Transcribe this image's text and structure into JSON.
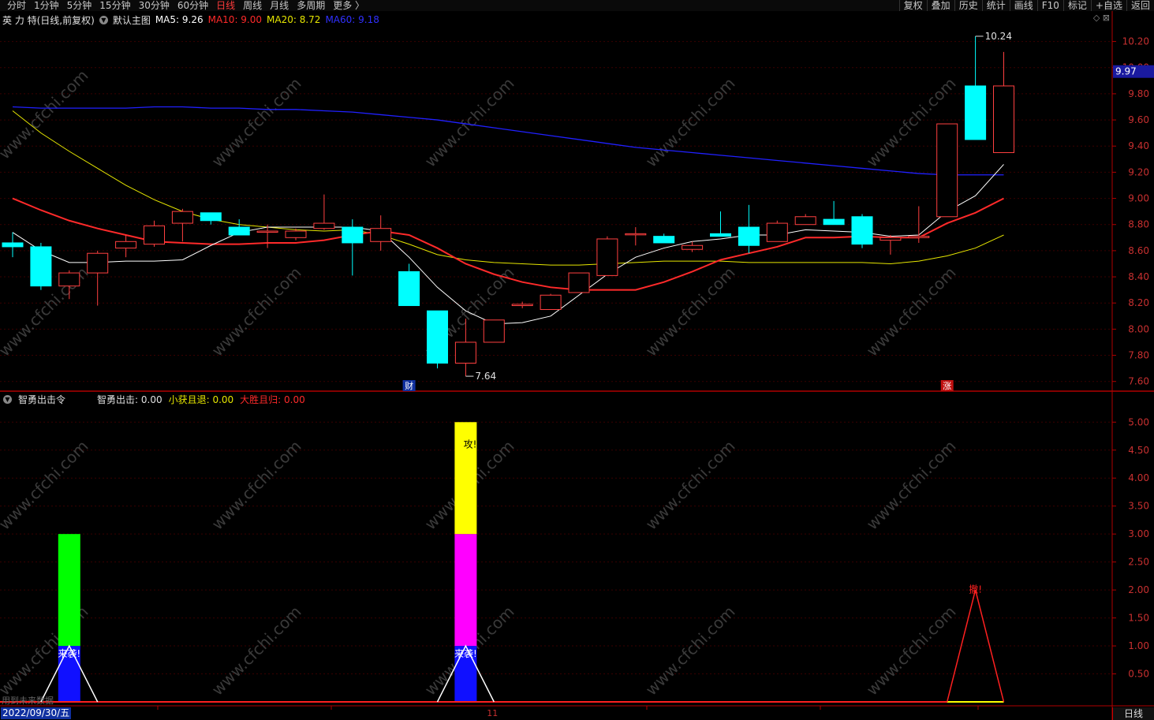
{
  "toolbar": {
    "left_items": [
      "分时",
      "1分钟",
      "5分钟",
      "15分钟",
      "30分钟",
      "60分钟",
      "日线",
      "周线",
      "月线",
      "多周期",
      "更多 〉"
    ],
    "active_index": 6,
    "right_items": [
      "复权",
      "叠加",
      "历史",
      "统计",
      "画线",
      "F10",
      "标记",
      "+自选",
      "返回"
    ]
  },
  "main_chart": {
    "stock_title": "英 力 特(日线,前复权)",
    "template_name": "默认主图",
    "ma5_label": "MA5: 9.26",
    "ma10_label": "MA10: 9.00",
    "ma20_label": "MA20: 8.72",
    "ma60_label": "MA60: 9.18",
    "high_label": "10.24",
    "low_label": "7.64",
    "current_price": "9.97",
    "event_marker_1": "财",
    "event_marker_2": "涨",
    "y_ticks": [
      "10.20",
      "10.00",
      "9.80",
      "9.60",
      "9.40",
      "9.20",
      "9.00",
      "8.80",
      "8.60",
      "8.40",
      "8.20",
      "8.00",
      "7.80",
      "7.60"
    ],
    "colors": {
      "ma5": "#ffffff",
      "ma10": "#ff2a2a",
      "ma20": "#e6e600",
      "ma60": "#2020ff",
      "up": "#ff4040",
      "down": "#00ffff"
    }
  },
  "indicator": {
    "name": "智勇出击令",
    "l1": "智勇出击: 0.00",
    "l2": "小获且退: 0.00",
    "l3": "大胜且归: 0.00",
    "y_ticks": [
      "5.00",
      "4.50",
      "4.00",
      "3.50",
      "3.00",
      "2.50",
      "2.00",
      "1.50",
      "1.00",
      "0.50"
    ],
    "signal_1": "来袭!",
    "signal_2": "来袭!",
    "signal_3": "攻!",
    "signal_4": "撤!"
  },
  "footer": {
    "date": "2022/09/30/五",
    "axis_mark": "11",
    "period_tab": "日线",
    "note": "用到未来数据"
  },
  "watermark": "www.cfchi.com",
  "chart_data": {
    "type": "candlestick",
    "y_range": [
      7.55,
      10.3
    ],
    "candles": [
      [
        8.66,
        8.63,
        8.74,
        8.55
      ],
      [
        8.63,
        8.33,
        8.66,
        8.3
      ],
      [
        8.33,
        8.43,
        8.45,
        8.23
      ],
      [
        8.43,
        8.58,
        8.6,
        8.18
      ],
      [
        8.62,
        8.67,
        8.72,
        8.55
      ],
      [
        8.65,
        8.79,
        8.83,
        8.63
      ],
      [
        8.81,
        8.9,
        8.92,
        8.67
      ],
      [
        8.89,
        8.83,
        8.89,
        8.8
      ],
      [
        8.78,
        8.72,
        8.84,
        8.72
      ],
      [
        8.75,
        8.75,
        8.8,
        8.62
      ],
      [
        8.7,
        8.75,
        8.77,
        8.68
      ],
      [
        8.77,
        8.81,
        9.03,
        8.76
      ],
      [
        8.78,
        8.66,
        8.84,
        8.41
      ],
      [
        8.67,
        8.77,
        8.87,
        8.6
      ],
      [
        8.44,
        8.18,
        8.5,
        8.18
      ],
      [
        8.14,
        7.74,
        8.14,
        7.7
      ],
      [
        7.74,
        7.9,
        8.08,
        7.64
      ],
      [
        7.9,
        8.07,
        8.07,
        7.9
      ],
      [
        8.18,
        8.19,
        8.21,
        8.16
      ],
      [
        8.15,
        8.26,
        8.27,
        8.15
      ],
      [
        8.28,
        8.43,
        8.43,
        8.28
      ],
      [
        8.41,
        8.69,
        8.71,
        8.41
      ],
      [
        8.73,
        8.73,
        8.78,
        8.64
      ],
      [
        8.71,
        8.66,
        8.73,
        8.66
      ],
      [
        8.61,
        8.64,
        8.67,
        8.59
      ],
      [
        8.73,
        8.71,
        8.9,
        8.71
      ],
      [
        8.78,
        8.64,
        8.95,
        8.58
      ],
      [
        8.67,
        8.81,
        8.83,
        8.67
      ],
      [
        8.8,
        8.86,
        8.88,
        8.8
      ],
      [
        8.84,
        8.8,
        8.98,
        8.8
      ],
      [
        8.86,
        8.65,
        8.88,
        8.62
      ],
      [
        8.68,
        8.7,
        8.72,
        8.57
      ],
      [
        8.7,
        8.71,
        8.94,
        8.66
      ],
      [
        8.86,
        9.57,
        9.57,
        8.86
      ],
      [
        9.86,
        9.45,
        10.24,
        9.45
      ],
      [
        9.35,
        9.86,
        10.12,
        9.35
      ]
    ],
    "ma5": [
      8.74,
      8.6,
      8.51,
      8.51,
      8.52,
      8.52,
      8.53,
      8.64,
      8.74,
      8.78,
      8.78,
      8.78,
      8.78,
      8.75,
      8.55,
      8.32,
      8.14,
      8.04,
      8.05,
      8.1,
      8.26,
      8.42,
      8.55,
      8.62,
      8.67,
      8.69,
      8.72,
      8.72,
      8.76,
      8.75,
      8.74,
      8.71,
      8.72,
      8.9,
      9.02,
      9.26
    ],
    "ma10": [
      9.0,
      8.91,
      8.83,
      8.77,
      8.72,
      8.67,
      8.66,
      8.65,
      8.65,
      8.66,
      8.66,
      8.68,
      8.72,
      8.75,
      8.72,
      8.62,
      8.5,
      8.42,
      8.36,
      8.32,
      8.3,
      8.3,
      8.3,
      8.36,
      8.44,
      8.53,
      8.58,
      8.63,
      8.7,
      8.7,
      8.71,
      8.7,
      8.7,
      8.81,
      8.89,
      9.0
    ],
    "ma20": [
      9.67,
      9.5,
      9.36,
      9.23,
      9.1,
      8.99,
      8.9,
      8.84,
      8.8,
      8.78,
      8.76,
      8.75,
      8.76,
      8.72,
      8.65,
      8.57,
      8.53,
      8.51,
      8.5,
      8.49,
      8.49,
      8.5,
      8.51,
      8.52,
      8.52,
      8.52,
      8.51,
      8.51,
      8.51,
      8.51,
      8.51,
      8.5,
      8.52,
      8.56,
      8.62,
      8.72
    ],
    "ma60": [
      9.7,
      9.69,
      9.69,
      9.69,
      9.69,
      9.7,
      9.7,
      9.69,
      9.69,
      9.68,
      9.68,
      9.67,
      9.66,
      9.64,
      9.62,
      9.6,
      9.57,
      9.54,
      9.51,
      9.48,
      9.45,
      9.42,
      9.39,
      9.37,
      9.35,
      9.33,
      9.31,
      9.29,
      9.27,
      9.25,
      9.23,
      9.21,
      9.19,
      9.18,
      9.18,
      9.18
    ],
    "indicator_range": [
      0,
      5.3
    ],
    "indicator_bars": [
      {
        "index": 2,
        "blue": 1.0,
        "green": 3.0
      },
      {
        "index": 16,
        "blue": 1.0,
        "magenta": 3.0,
        "yellow": 5.0
      }
    ],
    "indicator_triangles": [
      {
        "index": 2,
        "peak": 1.0,
        "color": "#ffffff"
      },
      {
        "index": 16,
        "peak": 1.0,
        "color": "#ffffff"
      },
      {
        "index": 34,
        "peak": 2.0,
        "color": "#ff2020"
      }
    ]
  }
}
